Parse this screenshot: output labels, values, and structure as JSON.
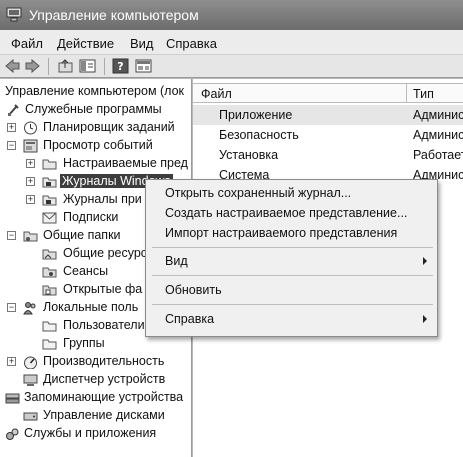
{
  "window": {
    "title": "Управление компьютером",
    "icon": "computer-management-icon"
  },
  "menubar": {
    "items": [
      "Файл",
      "Действие",
      "Вид",
      "Справка"
    ]
  },
  "toolbar": {
    "buttons": [
      "back-arrow-icon",
      "forward-arrow-icon",
      "up-folder-icon",
      "show-tree-icon",
      "help-icon",
      "properties-icon"
    ]
  },
  "tree": {
    "items": [
      {
        "label": "Управление компьютером (лок",
        "icon": "computer-icon"
      },
      {
        "label": "Служебные программы",
        "icon": "tools-icon"
      },
      {
        "label": "Планировщик заданий",
        "icon": "clock-icon"
      },
      {
        "label": "Просмотр событий",
        "icon": "event-viewer-icon"
      },
      {
        "label": "Настраиваемые пред",
        "icon": "folder-icon"
      },
      {
        "label": "Журналы Windows",
        "icon": "log-folder-icon"
      },
      {
        "label": "Журналы при",
        "icon": "log-folder-icon"
      },
      {
        "label": "Подписки",
        "icon": "subscriptions-icon"
      },
      {
        "label": "Общие папки",
        "icon": "shared-folders-icon"
      },
      {
        "label": "Общие ресурс",
        "icon": "share-icon"
      },
      {
        "label": "Сеансы",
        "icon": "sessions-icon"
      },
      {
        "label": "Открытые фа",
        "icon": "open-files-icon"
      },
      {
        "label": "Локальные поль",
        "icon": "users-icon"
      },
      {
        "label": "Пользователи",
        "icon": "folder-icon"
      },
      {
        "label": "Группы",
        "icon": "folder-icon"
      },
      {
        "label": "Производительность",
        "icon": "performance-icon"
      },
      {
        "label": "Диспетчер устройств",
        "icon": "device-manager-icon"
      },
      {
        "label": "Запоминающие устройства",
        "icon": "storage-icon"
      },
      {
        "label": "Управление дисками",
        "icon": "disk-icon"
      },
      {
        "label": "Службы и приложения",
        "icon": "services-icon"
      }
    ]
  },
  "list": {
    "columns": [
      "Файл",
      "Тип"
    ],
    "rows": [
      {
        "name": "Приложение",
        "type": "Админис"
      },
      {
        "name": "Безопасность",
        "type": "Админис"
      },
      {
        "name": "Установка",
        "type": "Работает"
      },
      {
        "name": "Система",
        "type": "Админис"
      }
    ]
  },
  "context_menu": {
    "items": [
      {
        "label": "Открыть сохраненный журнал..."
      },
      {
        "label": "Создать настраиваемое представление..."
      },
      {
        "label": "Импорт настраиваемого представления"
      },
      {
        "label": "Вид"
      },
      {
        "label": "Обновить"
      },
      {
        "label": "Справка"
      }
    ]
  }
}
